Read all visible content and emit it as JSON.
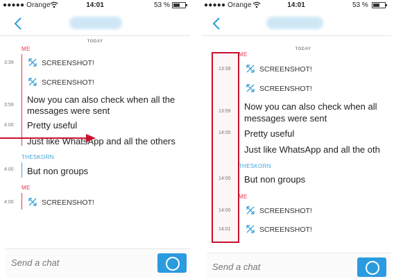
{
  "status_bar": {
    "carrier": "●●●●● Orange",
    "time": "14:01",
    "battery": "53 %"
  },
  "day_label": "TODAY",
  "compose": {
    "placeholder": "Send a chat"
  },
  "left": {
    "senders": {
      "me_1": "ME",
      "theskorn": "THESKORN",
      "me_2": "ME"
    },
    "timestamps": {
      "t1": "3:39",
      "t2": "3:59",
      "t3": "4:00",
      "t4": "4:00",
      "t5": "4:00"
    },
    "messages": {
      "shot1": "SCREENSHOT!",
      "shot2": "SCREENSHOT!",
      "text1a": "Now you can also check when all the",
      "text1b": "messages were sent",
      "text2": "Pretty useful",
      "text3": "Just like WhatsApp and all the others",
      "text4": "But non groups",
      "shot3": "SCREENSHOT!"
    }
  },
  "right": {
    "senders": {
      "me_1": "ME",
      "theskorn": "THESKORN",
      "me_2": "ME"
    },
    "timestamps": {
      "t1": "13:39",
      "t2": "13:59",
      "t3": "14:00",
      "t4": "14:00",
      "t5": "14:00",
      "t6": "14:01"
    },
    "messages": {
      "shot1": "SCREENSHOT!",
      "shot2": "SCREENSHOT!",
      "text1a": "Now you can also check when all",
      "text1b": "messages were sent",
      "text2": "Pretty useful",
      "text3": "Just like WhatsApp and all the oth",
      "text4": "But non groups",
      "shot3": "SCREENSHOT!",
      "shot4": "SCREENSHOT!"
    }
  },
  "colors": {
    "me": "#e3344f",
    "them": "#3fa5d8",
    "accent": "#2b9be0",
    "annotation": "#c8102e"
  }
}
